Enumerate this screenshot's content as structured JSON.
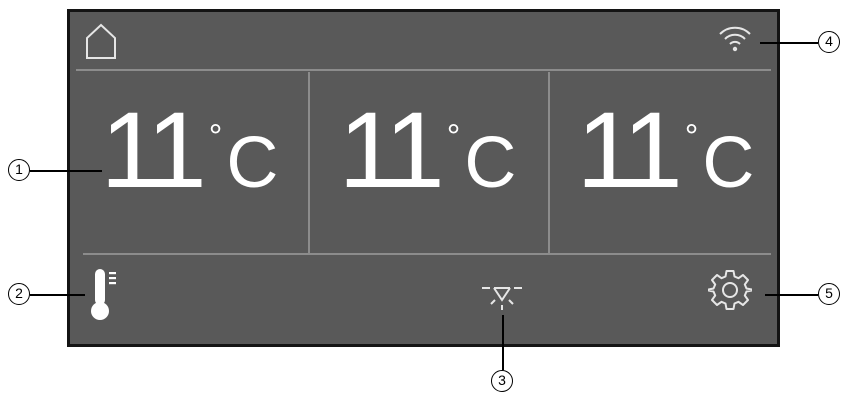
{
  "zones": [
    {
      "temperature": "11",
      "degree": "°",
      "unit": "C"
    },
    {
      "temperature": "11",
      "degree": "°",
      "unit": "C"
    },
    {
      "temperature": "11",
      "degree": "°",
      "unit": "C"
    }
  ],
  "icons": {
    "home": "home-icon",
    "wifi": "wifi-icon",
    "thermometer": "thermometer-icon",
    "light": "interior-light-icon",
    "settings": "gear-icon"
  },
  "callouts": {
    "c1": "1",
    "c2": "2",
    "c3": "3",
    "c4": "4",
    "c5": "5"
  },
  "colors": {
    "panel": "#595959",
    "border": "#141414",
    "divider": "#8c8c8c",
    "text": "#ffffff"
  }
}
